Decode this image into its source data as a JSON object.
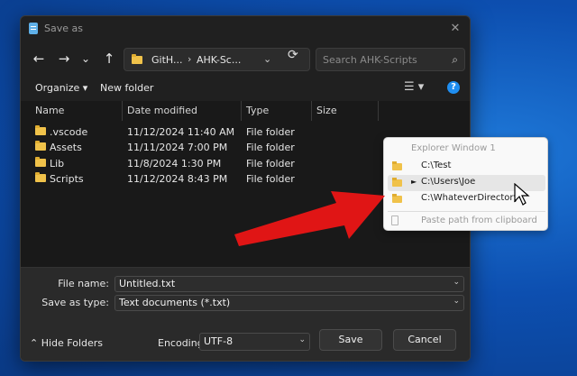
{
  "dialog": {
    "title": "Save as",
    "close_glyph": "✕"
  },
  "nav": {
    "back_glyph": "←",
    "forward_glyph": "→",
    "history_glyph": "⌄",
    "up_glyph": "↑",
    "breadcrumbs": [
      "GitH...",
      "AHK-Sc..."
    ],
    "crumb_sep": "›",
    "address_dropdown_glyph": "⌄",
    "refresh_glyph": "⟳",
    "search_placeholder": "Search AHK-Scripts",
    "search_glyph": "⌕"
  },
  "toolbar": {
    "organize": "Organize ▾",
    "new_folder": "New folder",
    "view_glyph": "☰ ▾",
    "help_glyph": "?"
  },
  "columns": [
    "Name",
    "Date modified",
    "Type",
    "Size"
  ],
  "files": [
    {
      "name": ".vscode",
      "date": "11/12/2024 11:40 AM",
      "type": "File folder",
      "size": ""
    },
    {
      "name": "Assets",
      "date": "11/11/2024 7:00 PM",
      "type": "File folder",
      "size": ""
    },
    {
      "name": "Lib",
      "date": "11/8/2024 1:30 PM",
      "type": "File folder",
      "size": ""
    },
    {
      "name": "Scripts",
      "date": "11/12/2024 8:43 PM",
      "type": "File folder",
      "size": ""
    }
  ],
  "form": {
    "file_name_label": "File name:",
    "file_name_value": "Untitled.txt",
    "save_type_label": "Save as type:",
    "save_type_value": "Text documents (*.txt)",
    "dropdown_glyph": "⌄",
    "hide_folders": "⌃ Hide Folders",
    "encoding_label": "Encoding:",
    "encoding_value": "UTF-8",
    "save_button": "Save",
    "cancel_button": "Cancel"
  },
  "popup": {
    "title": "Explorer Window 1",
    "items": [
      {
        "label": "C:\\Test",
        "marker": ""
      },
      {
        "label": "C:\\Users\\Joe",
        "marker": "►"
      },
      {
        "label": "C:\\WhateverDirectory",
        "marker": ""
      }
    ],
    "paste_label": "Paste path from clipboard"
  },
  "colors": {
    "arrow": "#e01515",
    "accent": "#1f8ef1",
    "folder": "#f0c24a"
  }
}
